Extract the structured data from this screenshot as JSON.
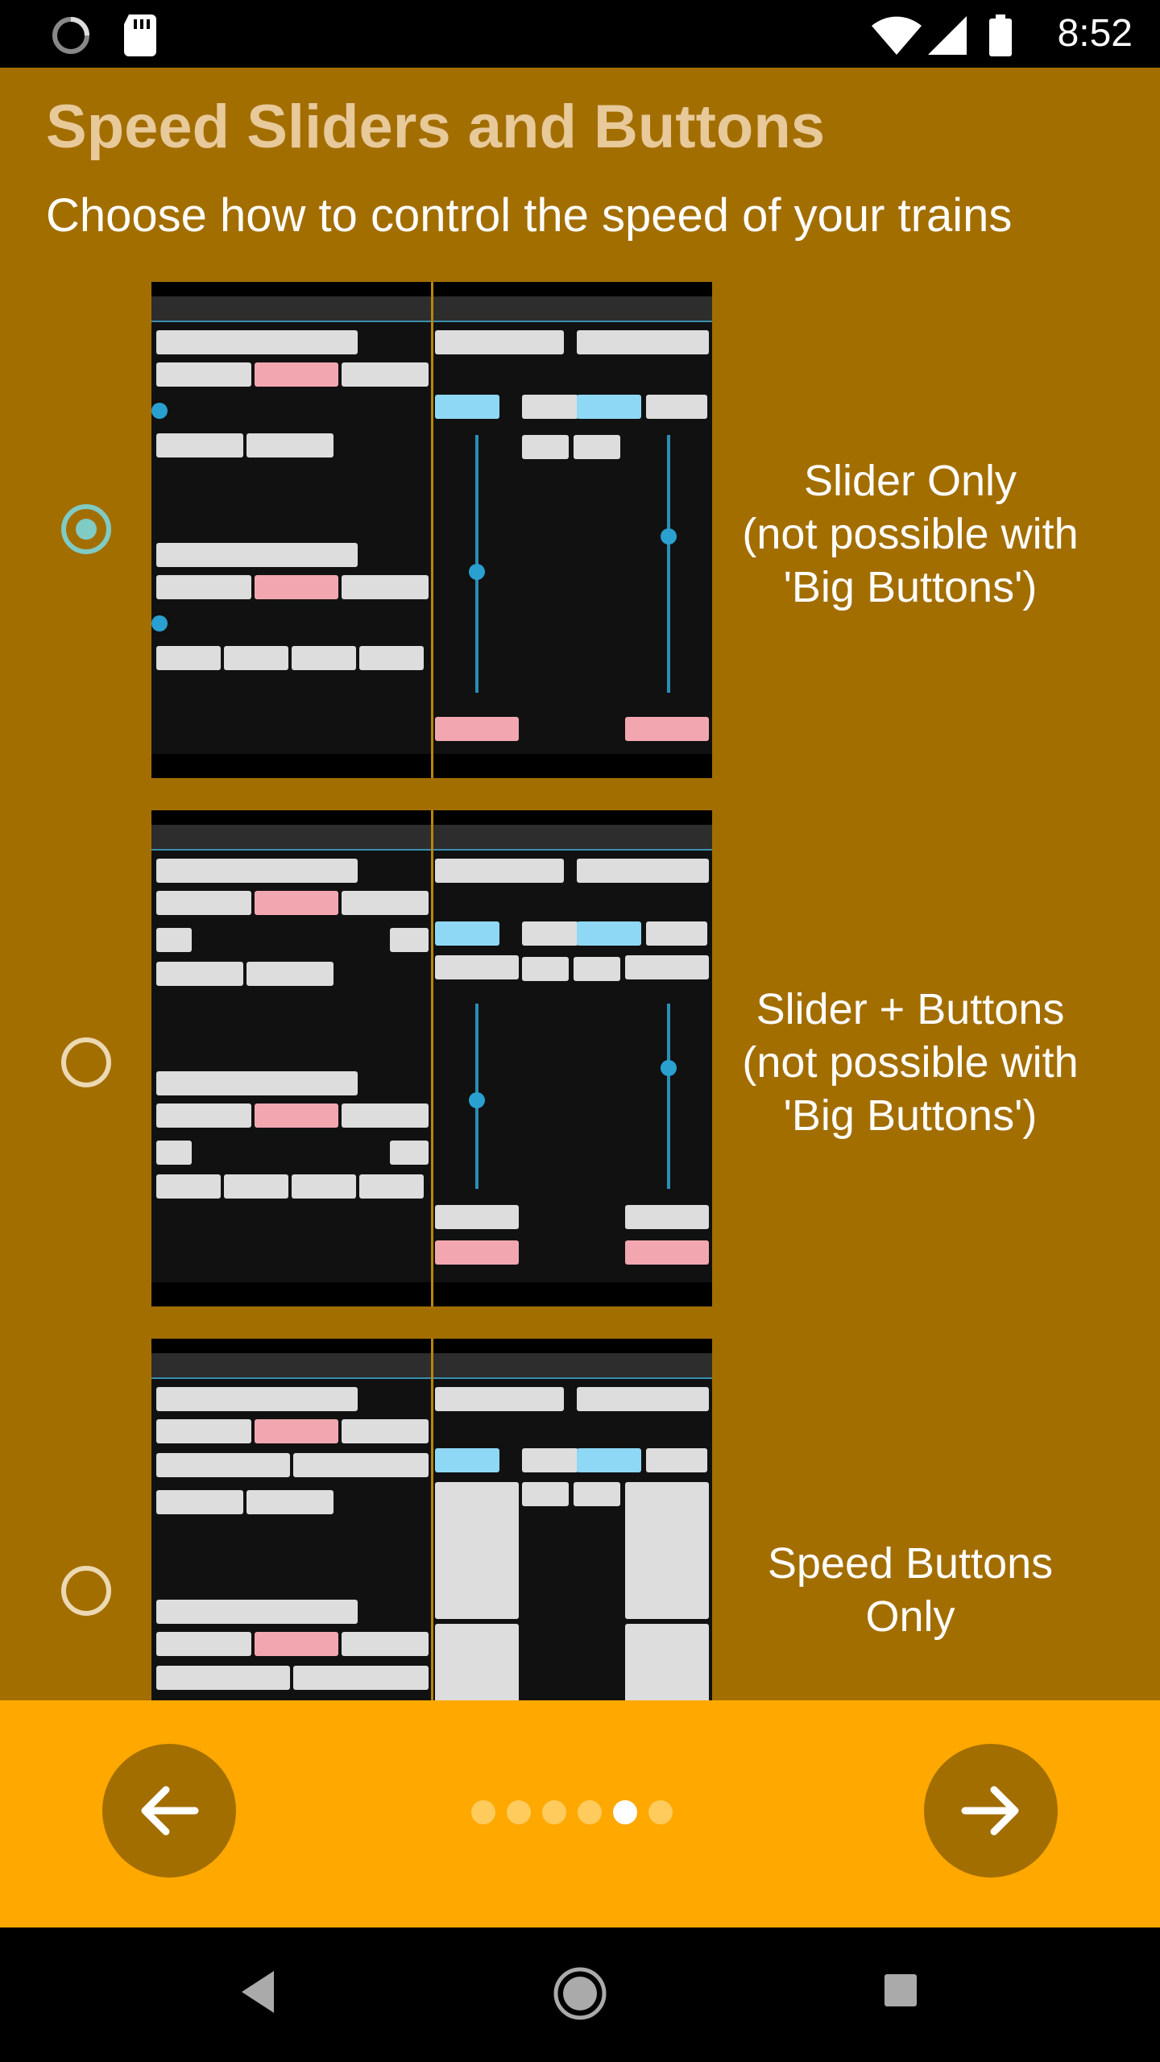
{
  "status_bar": {
    "time": "8:52"
  },
  "header": {
    "title": "Speed Sliders and Buttons",
    "subtitle": "Choose how to control the speed of your trains"
  },
  "options": [
    {
      "label": "Slider Only\n(not possible with\n'Big Buttons')",
      "selected": true,
      "preview_icon": "slider-only-screenshot"
    },
    {
      "label": "Slider + Buttons\n(not possible with\n'Big Buttons')",
      "selected": false,
      "preview_icon": "slider-buttons-screenshot"
    },
    {
      "label": "Speed Buttons\nOnly",
      "selected": false,
      "preview_icon": "speed-buttons-screenshot"
    }
  ],
  "pager": {
    "page_count": 6,
    "current_page_index": 4
  },
  "nav": {
    "back_icon": "arrow-left-icon",
    "next_icon": "arrow-right-icon"
  },
  "colors": {
    "background": "#a36e00",
    "bottom_bar": "#ffa800",
    "radio_selected": "#80cbc4",
    "title": "#e7c99a"
  }
}
